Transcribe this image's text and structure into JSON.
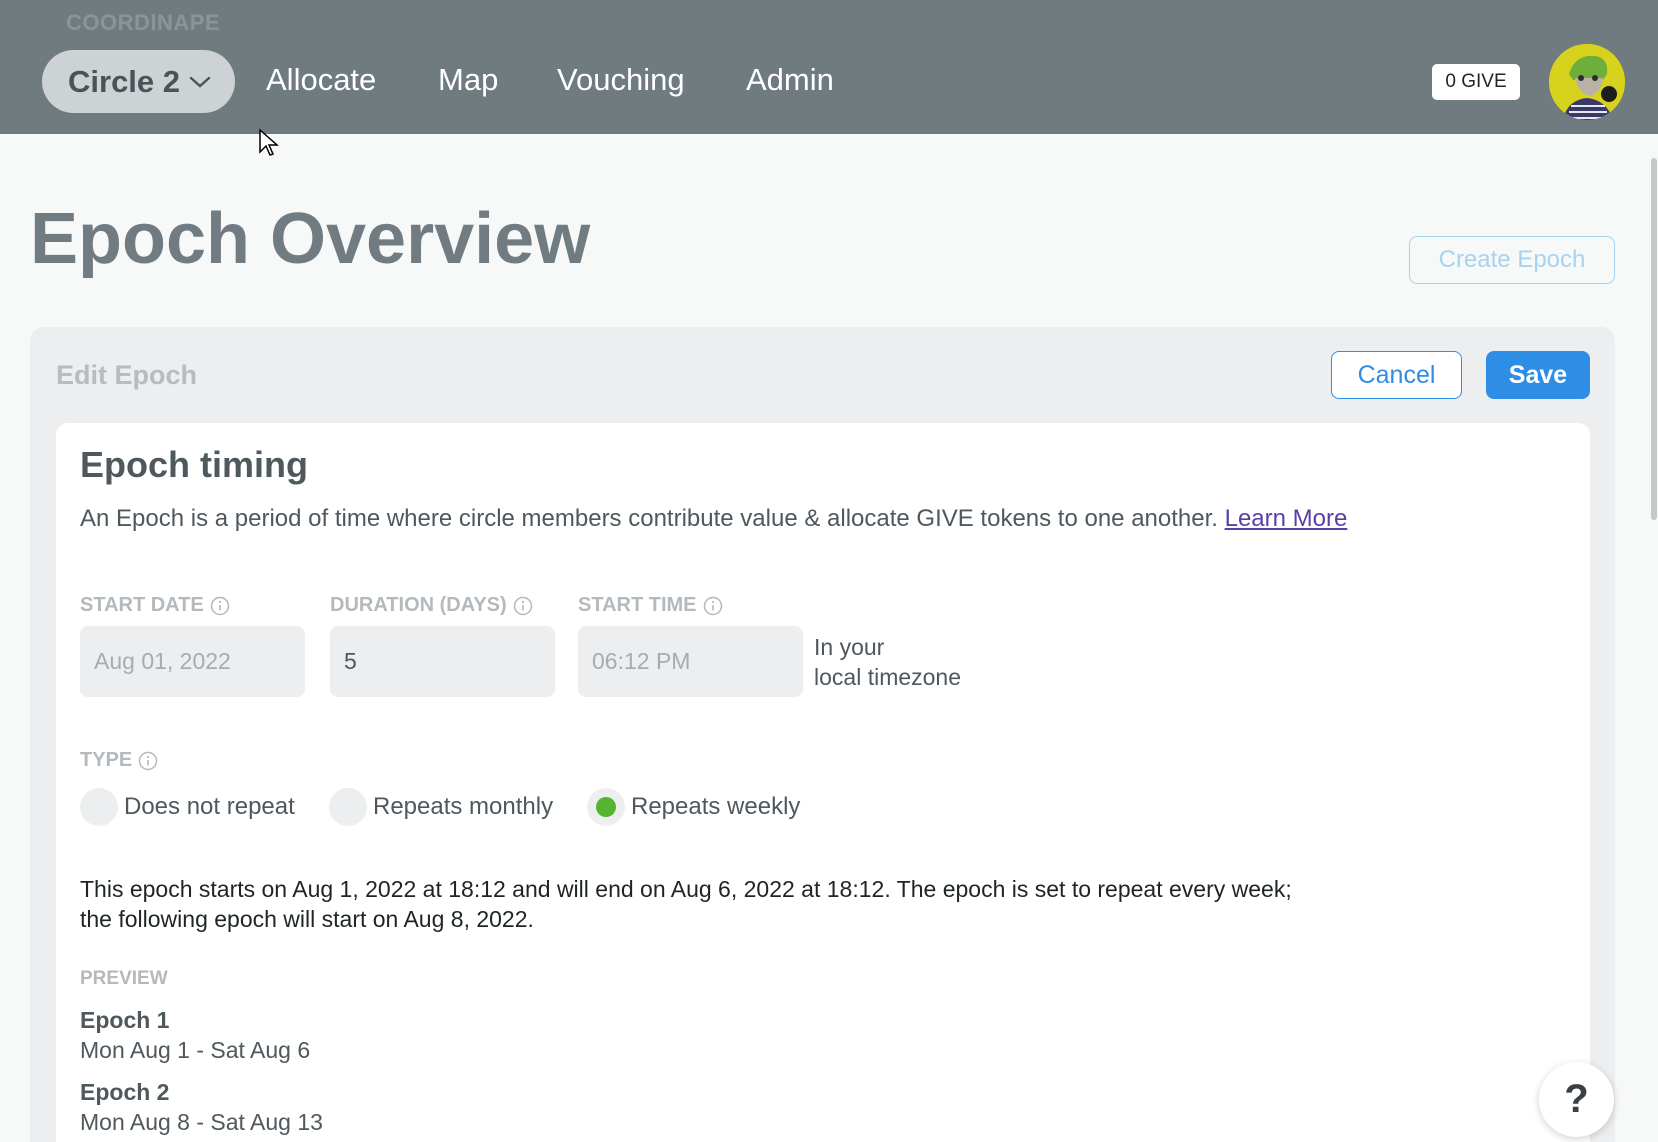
{
  "header": {
    "brand": "COORDINAPE",
    "circle_label": "Circle 2",
    "nav": [
      "Allocate",
      "Map",
      "Vouching",
      "Admin"
    ],
    "give_badge": "0 GIVE"
  },
  "page": {
    "title": "Epoch Overview",
    "create_button": "Create Epoch"
  },
  "edit": {
    "title": "Edit Epoch",
    "cancel_label": "Cancel",
    "save_label": "Save"
  },
  "timing": {
    "title": "Epoch timing",
    "description": "An Epoch is a period of time where circle members contribute value & allocate GIVE tokens to one another.",
    "learn_more": "Learn More",
    "start_date_label": "START DATE",
    "start_date_value": "Aug 01, 2022",
    "duration_label": "DURATION (DAYS)",
    "duration_value": "5",
    "start_time_label": "START TIME",
    "start_time_value": "06:12 PM",
    "tz_line1": "In your",
    "tz_line2": "local timezone",
    "type_label": "TYPE",
    "types": [
      {
        "label": "Does not repeat",
        "selected": false
      },
      {
        "label": "Repeats monthly",
        "selected": false
      },
      {
        "label": "Repeats weekly",
        "selected": true
      }
    ],
    "summary_line1": "This epoch starts on Aug 1, 2022 at 18:12 and will end on Aug 6, 2022 at 18:12. The epoch is set to repeat every week;",
    "summary_line2": "the following epoch will start on Aug 8, 2022.",
    "preview_label": "PREVIEW",
    "preview": [
      {
        "name": "Epoch 1",
        "range": "Mon Aug 1 - Sat Aug 6"
      },
      {
        "name": "Epoch 2",
        "range": "Mon Aug 8 - Sat Aug 13"
      }
    ]
  },
  "help": "?",
  "colors": {
    "header_bg": "#707b80",
    "accent": "#2e8de4",
    "selected_radio": "#55b52f"
  }
}
